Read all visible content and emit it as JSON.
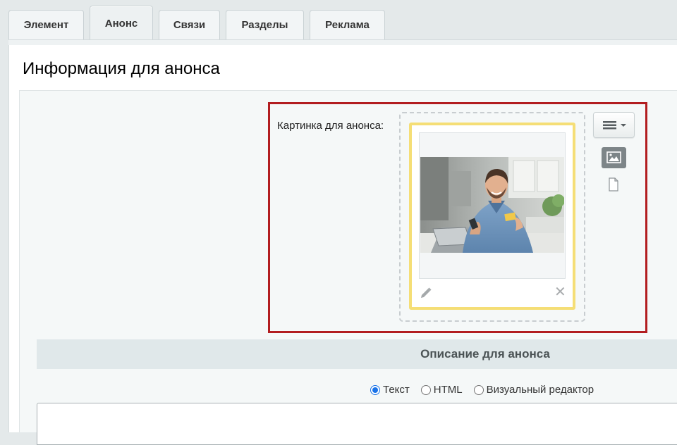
{
  "tabs": [
    {
      "label": "Элемент",
      "active": false
    },
    {
      "label": "Анонс",
      "active": true
    },
    {
      "label": "Связи",
      "active": false
    },
    {
      "label": "Разделы",
      "active": false
    },
    {
      "label": "Реклама",
      "active": false
    }
  ],
  "panel": {
    "title": "Информация для анонса"
  },
  "image_field": {
    "label": "Картинка для анонса:",
    "icons": {
      "edit": "pencil-icon",
      "remove": "close-icon",
      "menu": "hamburger-menu-icon",
      "image_type": "image-icon",
      "file_type": "file-icon"
    }
  },
  "description": {
    "header": "Описание для анонса",
    "modes": [
      "Текст",
      "HTML",
      "Визуальный редактор"
    ],
    "selected_mode": "Текст",
    "text": ""
  },
  "colors": {
    "highlight_border": "#b21d20",
    "card_border": "#f5de76",
    "radio_accent": "#1a73e8"
  }
}
